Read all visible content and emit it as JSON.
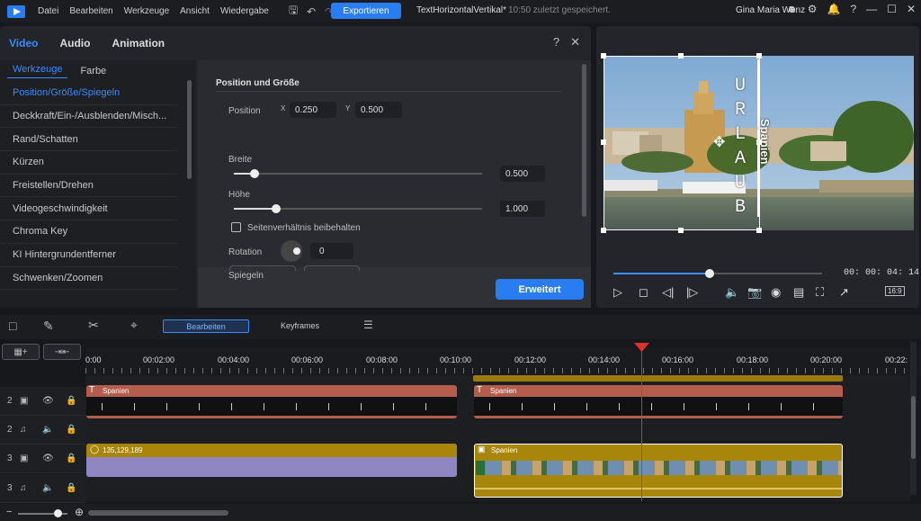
{
  "menubar": {
    "items": [
      "Datei",
      "Bearbeiten",
      "Werkzeuge",
      "Ansicht",
      "Wiedergabe"
    ],
    "export_label": "Exportieren",
    "project_name": "TextHorizontalVertikal*",
    "saved_status": "10:50 zuletzt gespeichert.",
    "user": "Gina Maria Wenz"
  },
  "edit_panel": {
    "tabs": [
      "Video",
      "Audio",
      "Animation"
    ],
    "subtabs": [
      "Werkzeuge",
      "Farbe"
    ],
    "tools": [
      "Position/Größe/Spiegeln",
      "Deckkraft/Ein-/Ausblenden/Misch...",
      "Rand/Schatten",
      "Kürzen",
      "Freistellen/Drehen",
      "Videogeschwindigkeit",
      "Chroma Key",
      "KI Hintergrundentferner",
      "Schwenken/Zoomen"
    ],
    "section_title": "Position und Größe",
    "position_label": "Position",
    "x_label": "X",
    "x_value": "0.250",
    "y_label": "Y",
    "y_value": "0.500",
    "width_label": "Breite",
    "width_value": "0.500",
    "height_label": "Höhe",
    "height_value": "1.000",
    "aspect_label": "Seitenverhältnis beibehalten",
    "rotation_label": "Rotation",
    "rotation_value": "0",
    "mirror_label": "Spiegeln",
    "advanced_label": "Erweitert"
  },
  "preview": {
    "timecode": "00: 00: 04: 14",
    "ratio": "16:9",
    "progress": 0.46,
    "text_vertical": [
      "U",
      "R",
      "L",
      "A",
      "U",
      "B"
    ],
    "text_rotated": "Spanien"
  },
  "timeline": {
    "edit_tab": "Bearbeiten",
    "keyframes_tab": "Keyframes",
    "ruler_labels": [
      "0:00",
      "00:02:00",
      "00:04:00",
      "00:06:00",
      "00:08:00",
      "00:10:00",
      "00:12:00",
      "00:14:00",
      "00:16:00",
      "00:18:00",
      "00:20:00",
      "00:22:"
    ],
    "tracks": [
      {
        "num": "2",
        "type": "video"
      },
      {
        "num": "2",
        "type": "audio"
      },
      {
        "num": "3",
        "type": "video"
      },
      {
        "num": "3",
        "type": "audio"
      }
    ],
    "clips": {
      "text1": "Spanien",
      "text2": "Spanien",
      "color_clip": "135,129,189",
      "video_clip": "Spanien"
    }
  }
}
